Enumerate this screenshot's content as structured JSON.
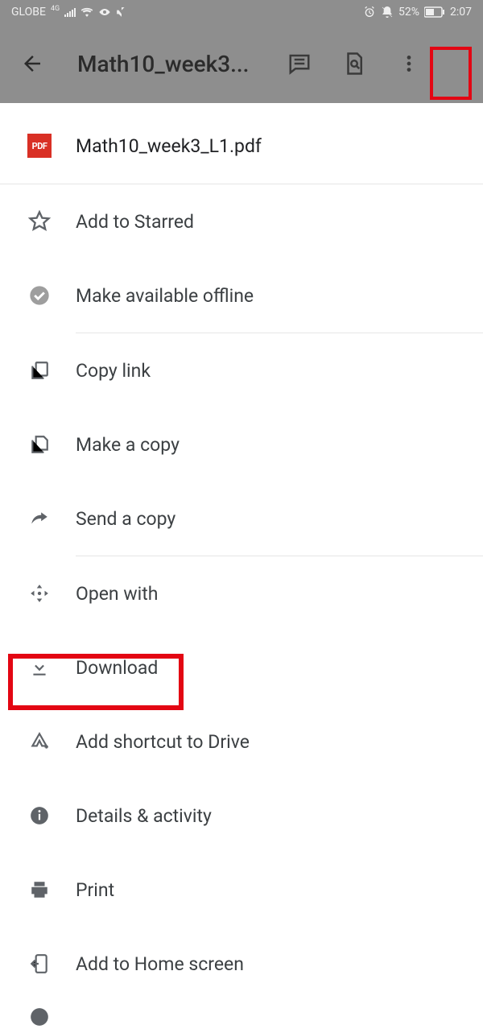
{
  "status": {
    "carrier": "GLOBE",
    "network_type": "4G",
    "battery_text": "52%",
    "time": "2:07"
  },
  "appbar": {
    "title": "Math10_week3...",
    "pdf_label": "PDF"
  },
  "file": {
    "name": "Math10_week3_L1.pdf"
  },
  "menu": {
    "star": "Add to Starred",
    "offline": "Make available offline",
    "copylink": "Copy link",
    "makecopy": "Make a copy",
    "sendcopy": "Send a copy",
    "openwith": "Open with",
    "download": "Download",
    "shortcut": "Add shortcut to Drive",
    "details": "Details & activity",
    "print": "Print",
    "homescreen": "Add to Home screen"
  }
}
